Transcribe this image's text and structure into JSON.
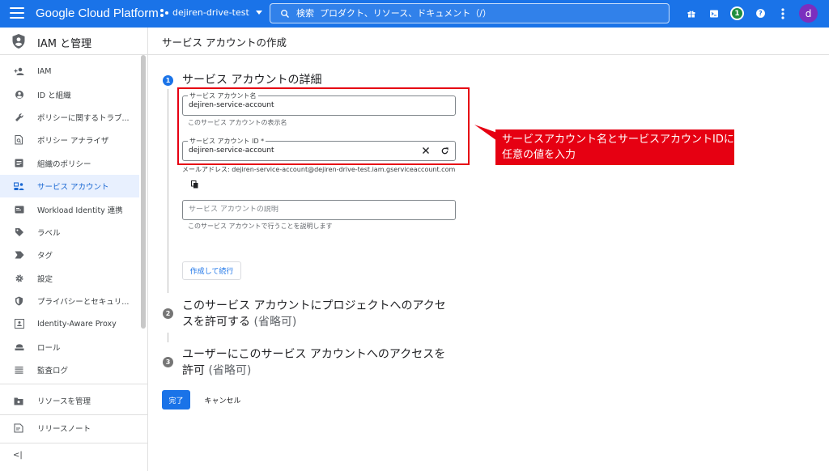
{
  "topbar": {
    "brand": "Google Cloud Platform",
    "project": "dejiren-drive-test",
    "search_placeholder": "検索  プロダクト、リソース、ドキュメント（/）",
    "notification_count": "1",
    "avatar_letter": "d",
    "color": "#1a73e8"
  },
  "sidebar": {
    "title": "IAM と管理",
    "items": [
      {
        "label": "IAM",
        "icon": "person-add-icon"
      },
      {
        "label": "ID と組織",
        "icon": "account-circle-icon"
      },
      {
        "label": "ポリシーに関するトラブ...",
        "icon": "wrench-icon"
      },
      {
        "label": "ポリシー アナライザ",
        "icon": "document-search-icon"
      },
      {
        "label": "組織のポリシー",
        "icon": "list-box-icon"
      },
      {
        "label": "サービス アカウント",
        "icon": "service-account-icon",
        "active": true
      },
      {
        "label": "Workload Identity 連携",
        "icon": "id-card-icon"
      },
      {
        "label": "ラベル",
        "icon": "label-icon"
      },
      {
        "label": "タグ",
        "icon": "tag-icon"
      },
      {
        "label": "設定",
        "icon": "gear-icon"
      },
      {
        "label": "プライバシーとセキュリ...",
        "icon": "shield-icon"
      },
      {
        "label": "Identity-Aware Proxy",
        "icon": "proxy-icon"
      },
      {
        "label": "ロール",
        "icon": "role-icon"
      },
      {
        "label": "監査ログ",
        "icon": "list-icon"
      }
    ],
    "manage_resources": "リソースを管理",
    "release_notes": "リリースノート",
    "collapse": "<|"
  },
  "main": {
    "page_title": "サービス アカウントの作成",
    "step1": {
      "number": "1",
      "title": "サービス アカウントの詳細",
      "name_label": "サービス アカウント名",
      "name_value": "dejiren-service-account",
      "name_hint": "このサービス アカウントの表示名",
      "id_label": "サービス アカウント ID *",
      "id_value": "dejiren-service-account",
      "email_text": "メールアドレス: dejiren-service-account@dejiren-drive-test.iam.gserviceaccount.com",
      "desc_placeholder": "サービス アカウントの説明",
      "desc_hint": "このサービス アカウントで行うことを説明します",
      "create_continue": "作成して続行"
    },
    "step2": {
      "number": "2",
      "title_line1": "このサービス アカウントにプロジェクトへのアクセ",
      "title_line2": "スを許可する",
      "optional": "(省略可)"
    },
    "step3": {
      "number": "3",
      "title_line1": "ユーザーにこのサービス アカウントへのアクセスを",
      "title_line2": "許可",
      "optional": "(省略可)"
    },
    "done": "完了",
    "cancel": "キャンセル"
  },
  "annotation": {
    "line1": "サービスアカウント名とサービスアカウントIDに",
    "line2": "任意の値を入力",
    "color": "#e60012"
  }
}
